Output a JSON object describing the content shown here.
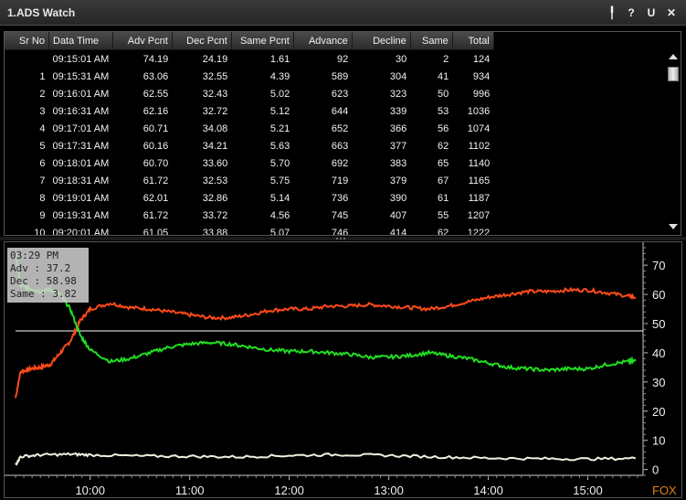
{
  "window": {
    "title": "1.ADS Watch",
    "buttons": [
      {
        "name": "pin-icon",
        "glyph": "╿"
      },
      {
        "name": "help-icon",
        "glyph": "?"
      },
      {
        "name": "undock-icon",
        "glyph": "U"
      },
      {
        "name": "close-icon",
        "glyph": "✕"
      }
    ]
  },
  "table": {
    "columns": [
      "Sr No",
      "Data Time",
      "Adv Pcnt",
      "Dec Pcnt",
      "Same Pcnt",
      "Advance",
      "Decline",
      "Same",
      "Total"
    ],
    "rows": [
      [
        "",
        "09:15:01 AM",
        "74.19",
        "24.19",
        "1.61",
        "92",
        "30",
        "2",
        "124"
      ],
      [
        "1",
        "09:15:31 AM",
        "63.06",
        "32.55",
        "4.39",
        "589",
        "304",
        "41",
        "934"
      ],
      [
        "2",
        "09:16:01 AM",
        "62.55",
        "32.43",
        "5.02",
        "623",
        "323",
        "50",
        "996"
      ],
      [
        "3",
        "09:16:31 AM",
        "62.16",
        "32.72",
        "5.12",
        "644",
        "339",
        "53",
        "1036"
      ],
      [
        "4",
        "09:17:01 AM",
        "60.71",
        "34.08",
        "5.21",
        "652",
        "366",
        "56",
        "1074"
      ],
      [
        "5",
        "09:17:31 AM",
        "60.16",
        "34.21",
        "5.63",
        "663",
        "377",
        "62",
        "1102"
      ],
      [
        "6",
        "09:18:01 AM",
        "60.70",
        "33.60",
        "5.70",
        "692",
        "383",
        "65",
        "1140"
      ],
      [
        "7",
        "09:18:31 AM",
        "61.72",
        "32.53",
        "5.75",
        "719",
        "379",
        "67",
        "1165"
      ],
      [
        "8",
        "09:19:01 AM",
        "62.01",
        "32.86",
        "5.14",
        "736",
        "390",
        "61",
        "1187"
      ],
      [
        "9",
        "09:19:31 AM",
        "61.72",
        "33.72",
        "4.56",
        "745",
        "407",
        "55",
        "1207"
      ],
      [
        "10",
        "09:20:01 AM",
        "61.05",
        "33.88",
        "5.07",
        "746",
        "414",
        "62",
        "1222"
      ]
    ]
  },
  "tooltip": {
    "time": "03:29 PM",
    "adv": "Adv : 37.2",
    "dec": "Dec : 58.98",
    "same": "Same : 3.82"
  },
  "chart_data": {
    "type": "line",
    "x_ticks": [
      "10:00",
      "11:00",
      "12:00",
      "13:00",
      "14:00",
      "15:00"
    ],
    "x_tick_hours": [
      10,
      11,
      12,
      13,
      14,
      15
    ],
    "x_range_hours": [
      9.25,
      15.5
    ],
    "y_ticks": [
      0,
      10,
      20,
      30,
      40,
      50,
      60,
      70
    ],
    "ylim": [
      -2,
      76
    ],
    "reference_line": 47.5,
    "watermark": "FOX",
    "colors": {
      "decline": "#ff4a1a",
      "advance": "#22dd22",
      "same": "#f0f0e0",
      "reference": "#ffffff",
      "axis": "#cccccc",
      "watermark": "#e08020"
    },
    "series": [
      {
        "key": "decline",
        "x": [
          9.25,
          9.3,
          9.4,
          9.5,
          9.6,
          9.7,
          9.8,
          9.9,
          10.0,
          10.2,
          10.4,
          10.6,
          10.8,
          11.0,
          11.2,
          11.4,
          11.6,
          11.8,
          12.0,
          12.2,
          12.4,
          12.6,
          12.8,
          13.0,
          13.2,
          13.4,
          13.6,
          13.8,
          14.0,
          14.2,
          14.4,
          14.6,
          14.8,
          15.0,
          15.2,
          15.4,
          15.48
        ],
        "values": [
          24.5,
          33.5,
          34.5,
          35,
          36,
          40,
          44,
          51,
          55,
          57,
          55.5,
          55,
          54,
          53,
          52,
          52,
          53,
          54.5,
          55,
          55,
          56,
          56,
          56.5,
          56,
          55.5,
          55,
          56,
          57.5,
          59,
          60,
          61,
          61,
          61.5,
          61.5,
          60.5,
          59.5,
          58.98
        ]
      },
      {
        "key": "advance",
        "x": [
          9.25,
          9.3,
          9.4,
          9.5,
          9.6,
          9.7,
          9.8,
          9.9,
          10.0,
          10.2,
          10.4,
          10.6,
          10.8,
          11.0,
          11.2,
          11.4,
          11.6,
          11.8,
          12.0,
          12.2,
          12.4,
          12.6,
          12.8,
          13.0,
          13.2,
          13.4,
          13.6,
          13.8,
          14.0,
          14.2,
          14.4,
          14.6,
          14.8,
          15.0,
          15.2,
          15.4,
          15.48
        ],
        "values": [
          74.19,
          63,
          62,
          61,
          61.7,
          60,
          55,
          46,
          41,
          37,
          38,
          40,
          42,
          43,
          43.5,
          43,
          42,
          41,
          40.5,
          40.5,
          40,
          39.5,
          38.5,
          38.5,
          39,
          40,
          39,
          38,
          36.5,
          35,
          34.5,
          34,
          34.5,
          34.5,
          36,
          37,
          37.2
        ]
      },
      {
        "key": "same",
        "x": [
          9.25,
          9.3,
          9.5,
          9.8,
          10.0,
          10.5,
          11.0,
          11.5,
          12.0,
          12.5,
          13.0,
          13.5,
          14.0,
          14.5,
          15.0,
          15.48
        ],
        "values": [
          1.61,
          4.4,
          5.0,
          5.2,
          5.0,
          4.6,
          4.5,
          4.3,
          4.8,
          5.1,
          4.8,
          4.3,
          3.9,
          3.7,
          3.6,
          3.82
        ]
      }
    ]
  }
}
